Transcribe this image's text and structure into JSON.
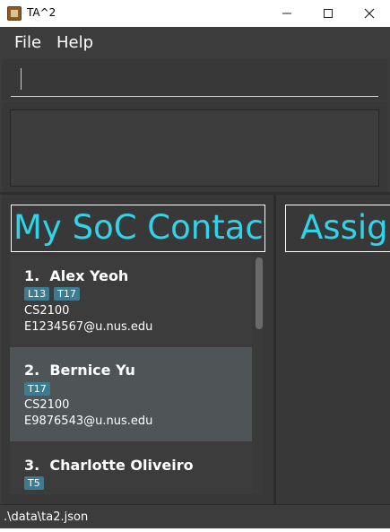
{
  "window": {
    "title": "TA^2"
  },
  "menu": {
    "file": "File",
    "help": "Help"
  },
  "command_box": {
    "value": ""
  },
  "panes": {
    "contacts_title": "My SoC Contacts",
    "assignments_title": "Assign"
  },
  "contacts": [
    {
      "index": "1.",
      "name": "Alex Yeoh",
      "tags": [
        "L13",
        "T17"
      ],
      "course": "CS2100",
      "email": "E1234567@u.nus.edu"
    },
    {
      "index": "2.",
      "name": "Bernice Yu",
      "tags": [
        "T17"
      ],
      "course": "CS2100",
      "email": "E9876543@u.nus.edu"
    },
    {
      "index": "3.",
      "name": "Charlotte Oliveiro",
      "tags": [
        "T5"
      ]
    }
  ],
  "status": {
    "file_path": ".\\data\\ta2.json"
  },
  "colors": {
    "accent": "#2fd3ea",
    "tag": "#3e7b91",
    "background": "#3c3c3c",
    "selected_card": "#4f5457"
  }
}
